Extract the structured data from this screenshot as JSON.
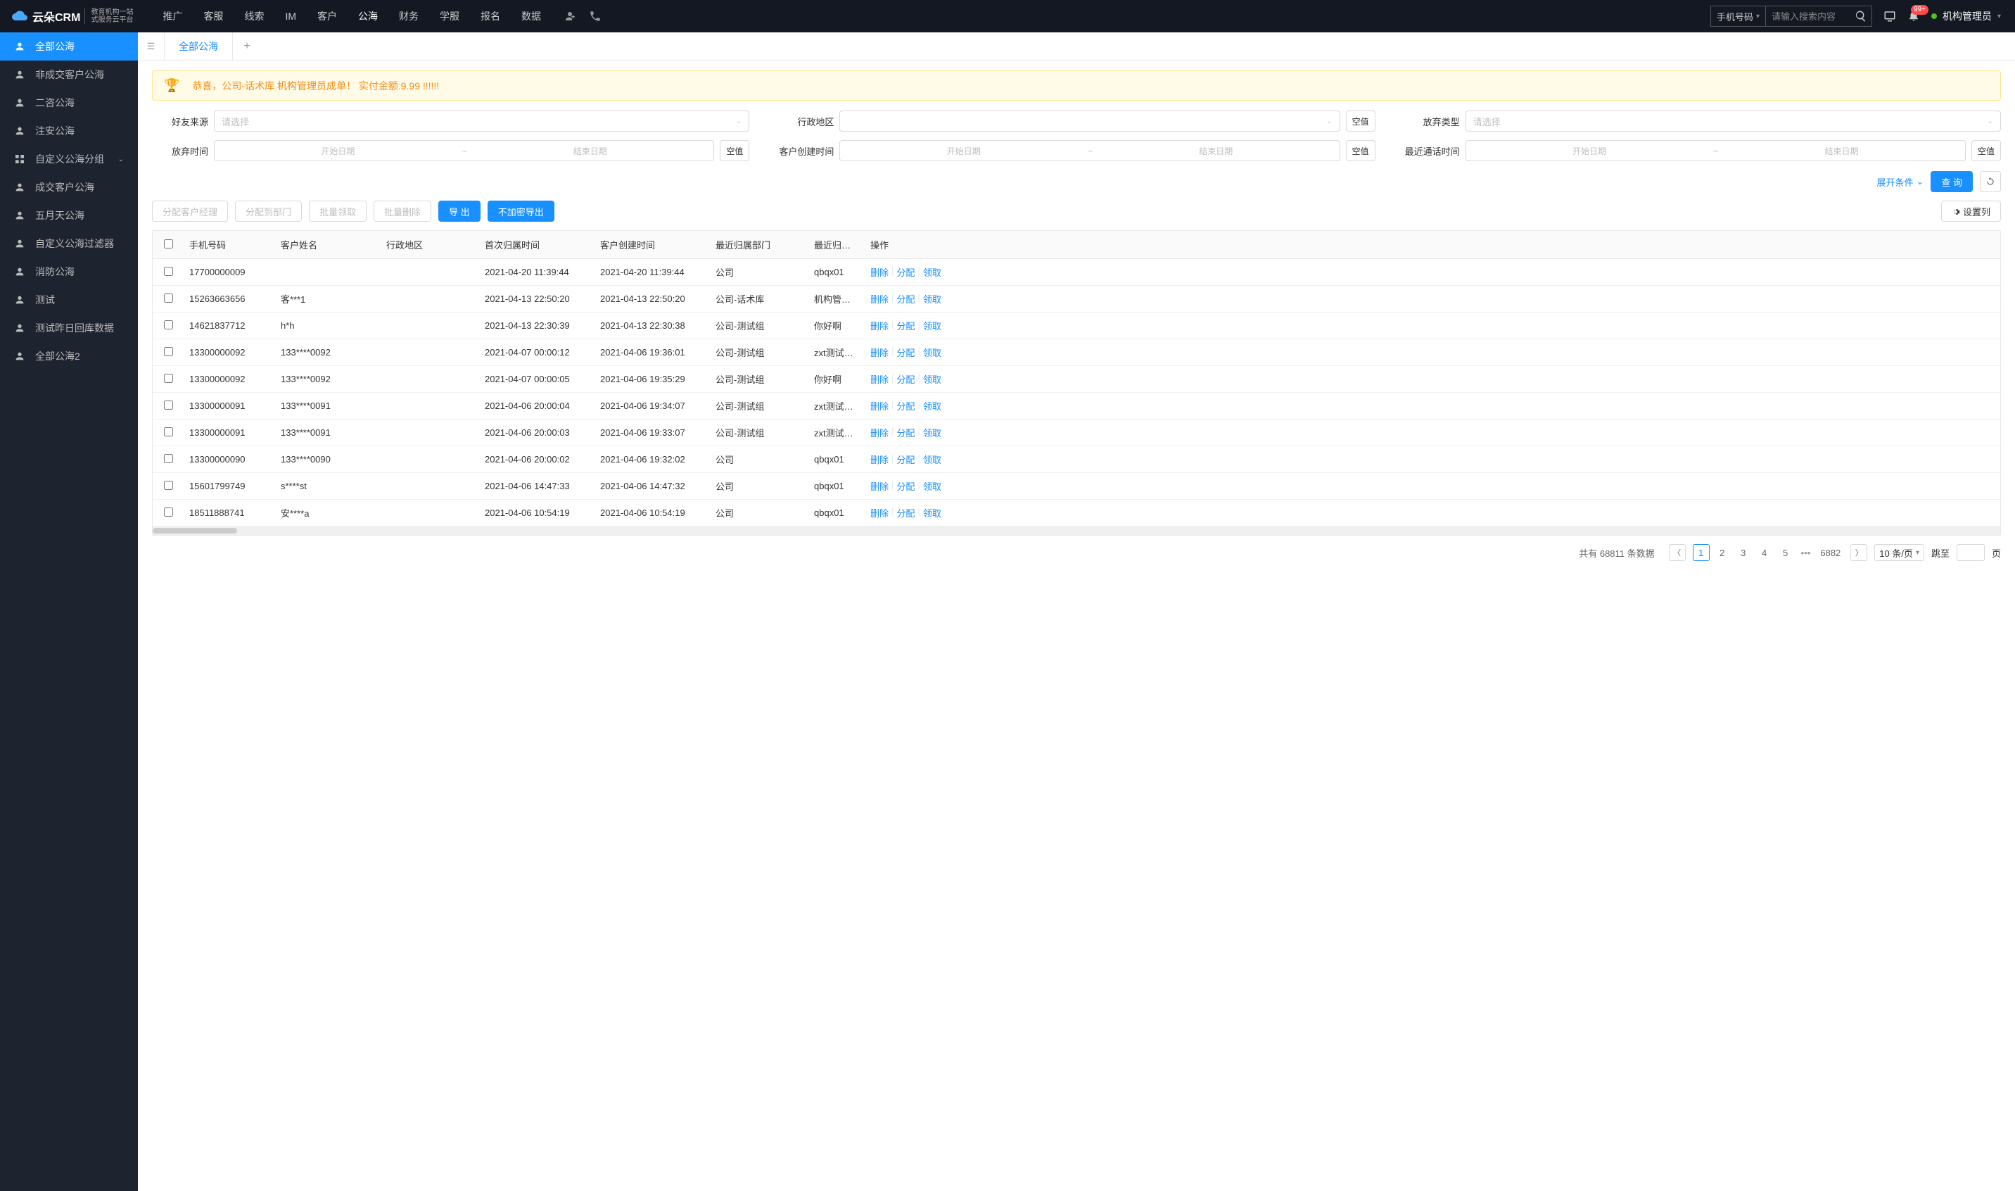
{
  "header": {
    "logo_main": "云朵CRM",
    "logo_sub_url": "www.yunduocrm.com",
    "logo_sub1": "教育机构一站",
    "logo_sub2": "式服务云平台",
    "nav": [
      "推广",
      "客服",
      "线索",
      "IM",
      "客户",
      "公海",
      "财务",
      "学服",
      "报名",
      "数据"
    ],
    "nav_active_index": 5,
    "search_type": "手机号码",
    "search_placeholder": "请输入搜索内容",
    "badge": "99+",
    "user": "机构管理员"
  },
  "sidebar": {
    "items": [
      {
        "label": "全部公海",
        "icon": "person"
      },
      {
        "label": "非成交客户公海",
        "icon": "person"
      },
      {
        "label": "二咨公海",
        "icon": "person"
      },
      {
        "label": "注安公海",
        "icon": "person"
      },
      {
        "label": "自定义公海分组",
        "icon": "grid",
        "chev": true
      },
      {
        "label": "成交客户公海",
        "icon": "person"
      },
      {
        "label": "五月天公海",
        "icon": "person"
      },
      {
        "label": "自定义公海过滤器",
        "icon": "person"
      },
      {
        "label": "消防公海",
        "icon": "person"
      },
      {
        "label": "测试",
        "icon": "person"
      },
      {
        "label": "测试昨日回库数据",
        "icon": "person"
      },
      {
        "label": "全部公海2",
        "icon": "person"
      }
    ],
    "active_index": 0
  },
  "tabs": {
    "active": "全部公海"
  },
  "banner": "恭喜，公司-话术库  机构管理员成单！  实付金额:9.99 !!!!!!",
  "filters": {
    "friend_source": {
      "label": "好友来源",
      "placeholder": "请选择"
    },
    "admin_region": {
      "label": "行政地区",
      "placeholder": "",
      "empty": "空值"
    },
    "abandon_type": {
      "label": "放弃类型",
      "placeholder": "请选择"
    },
    "abandon_time": {
      "label": "放弃时间",
      "start": "开始日期",
      "end": "结束日期",
      "empty": "空值"
    },
    "customer_create": {
      "label": "客户创建时间",
      "start": "开始日期",
      "end": "结束日期",
      "empty": "空值"
    },
    "recent_call": {
      "label": "最近通话时间",
      "start": "开始日期",
      "end": "结束日期",
      "empty": "空值"
    },
    "expand": "展开条件",
    "query": "查 询"
  },
  "buttons": {
    "assign_mgr": "分配客户经理",
    "assign_dept": "分配到部门",
    "bulk_claim": "批量领取",
    "bulk_delete": "批量删除",
    "export": "导 出",
    "export_plain": "不加密导出",
    "set_cols": "设置列"
  },
  "table": {
    "headers": [
      "手机号码",
      "客户姓名",
      "行政地区",
      "首次归属时间",
      "客户创建时间",
      "最近归属部门",
      "最近归属人",
      "操作"
    ],
    "ops": {
      "del": "删除",
      "assign": "分配",
      "claim": "领取"
    },
    "rows": [
      {
        "phone": "17700000009",
        "name": "",
        "region": "",
        "first": "2021-04-20 11:39:44",
        "create": "2021-04-20 11:39:44",
        "dept": "公司",
        "owner": "qbqx01"
      },
      {
        "phone": "15263663656",
        "name": "客***1",
        "region": "",
        "first": "2021-04-13 22:50:20",
        "create": "2021-04-13 22:50:20",
        "dept": "公司-话术库",
        "owner": "机构管理员"
      },
      {
        "phone": "14621837712",
        "name": "h*h",
        "region": "",
        "first": "2021-04-13 22:30:39",
        "create": "2021-04-13 22:30:38",
        "dept": "公司-测试组",
        "owner": "你好啊"
      },
      {
        "phone": "13300000092",
        "name": "133****0092",
        "region": "",
        "first": "2021-04-07 00:00:12",
        "create": "2021-04-06 19:36:01",
        "dept": "公司-测试组",
        "owner": "zxt测试导入"
      },
      {
        "phone": "13300000092",
        "name": "133****0092",
        "region": "",
        "first": "2021-04-07 00:00:05",
        "create": "2021-04-06 19:35:29",
        "dept": "公司-测试组",
        "owner": "你好啊"
      },
      {
        "phone": "13300000091",
        "name": "133****0091",
        "region": "",
        "first": "2021-04-06 20:00:04",
        "create": "2021-04-06 19:34:07",
        "dept": "公司-测试组",
        "owner": "zxt测试导入"
      },
      {
        "phone": "13300000091",
        "name": "133****0091",
        "region": "",
        "first": "2021-04-06 20:00:03",
        "create": "2021-04-06 19:33:07",
        "dept": "公司-测试组",
        "owner": "zxt测试导入"
      },
      {
        "phone": "13300000090",
        "name": "133****0090",
        "region": "",
        "first": "2021-04-06 20:00:02",
        "create": "2021-04-06 19:32:02",
        "dept": "公司",
        "owner": "qbqx01"
      },
      {
        "phone": "15601799749",
        "name": "s****st",
        "region": "",
        "first": "2021-04-06 14:47:33",
        "create": "2021-04-06 14:47:32",
        "dept": "公司",
        "owner": "qbqx01"
      },
      {
        "phone": "18511888741",
        "name": "安****a",
        "region": "",
        "first": "2021-04-06 10:54:19",
        "create": "2021-04-06 10:54:19",
        "dept": "公司",
        "owner": "qbqx01"
      }
    ]
  },
  "pager": {
    "total_prefix": "共有",
    "total": "68811",
    "total_suffix": "条数据",
    "pages": [
      "1",
      "2",
      "3",
      "4",
      "5"
    ],
    "last": "6882",
    "per_page": "10 条/页",
    "jump": "跳至",
    "page_suffix": "页"
  }
}
